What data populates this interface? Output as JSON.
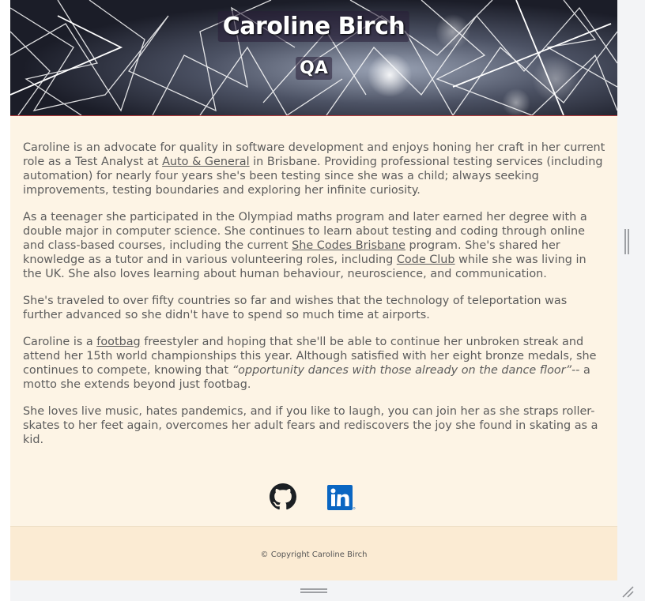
{
  "header": {
    "name": "Caroline Birch",
    "role": "QA"
  },
  "bio": {
    "p1": {
      "before": "Caroline is an advocate for quality in software development and enjoys honing her craft in her current role as a Test Analyst at ",
      "link": "Auto & General",
      "after": " in Brisbane. Providing professional testing services (including automation) for nearly four years she's been testing since she was a child; always seeking improvements, testing boundaries and exploring her infinite curiosity."
    },
    "p2": {
      "before": "As a teenager she participated in the Olympiad maths program and later earned her degree with a double major in computer science. She continues to learn about testing and coding through online and class-based courses, including the current ",
      "link1": "She Codes Brisbane",
      "middle": " program. She's shared her knowledge as a tutor and in various volunteering roles, including ",
      "link2": "Code Club",
      "after": " while she was living in the UK. She also loves learning about human behaviour, neuroscience, and communication."
    },
    "p3": "She's traveled to over fifty countries so far and wishes that the technology of teleportation was further advanced so she didn't have to spend so much time at airports.",
    "p4": {
      "before": "Caroline is a ",
      "link": "footbag",
      "middle": " freestyler and hoping that she'll be able to continue her unbroken streak and attend her 15th world championships this year. Although satisfied with her eight bronze medals, she continues to compete, knowing that ",
      "quote": "“opportunity dances with those already on the dance floor”",
      "after": "-- a motto she extends beyond just footbag."
    },
    "p5": "She loves live music, hates pandemics, and if you like to laugh, you can join her as she straps roller-skates to her feet again, overcomes her adult fears and rediscovers the joy she found in skating as a kid."
  },
  "social": {
    "icons": [
      "github-icon",
      "linkedin-icon"
    ],
    "linkedin_text": "in"
  },
  "footer": {
    "copyright": "© Copyright Caroline Birch"
  },
  "colors": {
    "page_bg": "#fdf4e5",
    "footer_bg": "#fbebd3",
    "text": "#5c5c5c",
    "linkedin_blue": "#0a66c2",
    "hero_accent_line": "#b73b3b"
  }
}
